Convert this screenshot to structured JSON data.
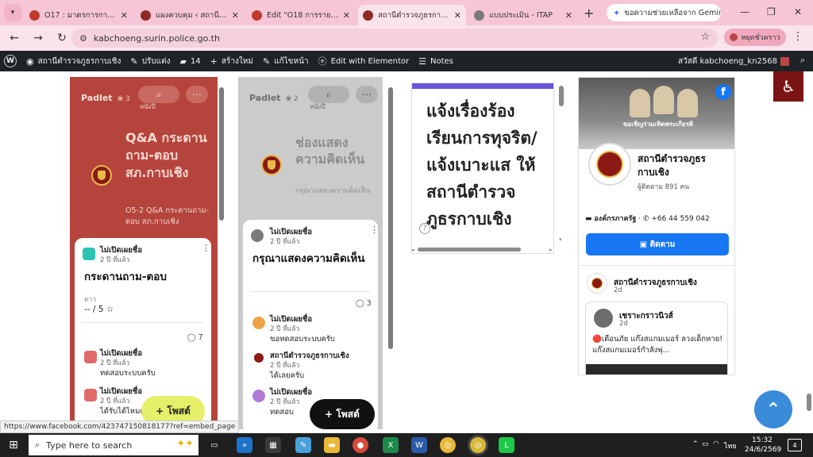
{
  "browser": {
    "tabs": [
      {
        "title": "O17 : มาตรการการแก้ไข",
        "favicon_color": "#c0392b"
      },
      {
        "title": "แผงควบคุม ‹ สถานีตำรวจ",
        "favicon_color": "#8e2a24"
      },
      {
        "title": "Edit \"O18 การรายงาน",
        "favicon_color": "#c0392b"
      },
      {
        "title": "สถานีตำรวจภูธรกาบเชิง",
        "favicon_color": "#8e2a24",
        "active": true
      },
      {
        "title": "แบบประเมิน - ITAP",
        "favicon_color": "#7a7a7a"
      }
    ],
    "new_tab_glyph": "+",
    "gemini_label": "ขอความช่วยเหลือจาก Gemini",
    "url": "kabchoeng.surin.police.go.th",
    "paused_label": "หยุดชั่วคราว",
    "status_url": "https://www.facebook.com/423747150818177?ref=embed_page"
  },
  "wpbar": {
    "site": "สถานีตำรวจภูธรกาบเชิง",
    "customize": "ปรับแต่ง",
    "comments_count": "14",
    "new": "สร้างใหม่",
    "edit_page": "แก้ไขหน้า",
    "elementor": "Edit with Elementor",
    "notes": "Notes",
    "greeting": "สวัสดี kabchoeng_kn2568"
  },
  "padlet1": {
    "brand": "Padlet",
    "count": "3",
    "search_label": "หนังปี",
    "title": "Q&A กระดานถาม-ตอบ สภ.กาบเชิง",
    "description": "O5-2 Q&A กระดานถาม-ตอบ สภ.กาบเชิง",
    "post": {
      "author": "ไม่เปิดเผยชื่อ",
      "time": "2 ปี ที่แล้ว",
      "title": "กระดานถาม-ตอบ",
      "rating_label": "ดาว",
      "rating_value": "-- / 5",
      "comments": "7"
    },
    "replies": [
      {
        "author": "ไม่เปิดเผยชื่อ",
        "time": "2 ปี ที่แล้ว",
        "text": "ทดสอบระบบครับ"
      },
      {
        "author": "ไม่เปิดเผยชื่อ",
        "time": "2 ปี ที่แล้ว",
        "text": "ได้รับได้ไหมครับ"
      }
    ],
    "post_button": "โพสต์",
    "bg_color": "#b5453c",
    "fab_color": "#e5ef6a"
  },
  "padlet2": {
    "brand": "Padlet",
    "count": "2",
    "search_label": "หนังปี",
    "title": "ช่องแสดงความคิดเห็น",
    "description": "กรุณาแสดงความคิดเห็น",
    "post": {
      "author": "ไม่เปิดเผยชื่อ",
      "time": "2 ปี ที่แล้ว",
      "title": "กรุณาแสดงความคิดเห็น",
      "comments": "3"
    },
    "replies": [
      {
        "author": "ไม่เปิดเผยชื่อ",
        "time": "2 ปี ที่แล้ว",
        "text": "ขอทดสอบระบบครับ",
        "color": "#f0a24a"
      },
      {
        "author": "สถานีตำรวจภูธรกาบเชิง",
        "time": "2 ปี ที่แล้ว",
        "text": "ได้เลยครับ",
        "color": "#8a1a14"
      },
      {
        "author": "ไม่เปิดเผยชื่อ",
        "time": "2 ปี ที่แล้ว",
        "text": "ทดสอบ",
        "color": "#b07ad8"
      }
    ],
    "post_button": "โพสต์",
    "bg_color": "#cbcbcb"
  },
  "report_text": "แจ้งเรื่องร้องเรียนการทุจริต/แจ้งเบาะแส ให้สถานีตำรวจภูธรกาบเชิง",
  "facebook": {
    "cover_caption": "ขอเชิญร่วมเทิดพระเกียรติ",
    "page_name": "สถานีตำรวจภูธรกาบเชิง",
    "followers": "ผู้ติดตาม 891 คน",
    "category": "องค์กรภาครัฐ",
    "phone": "+66 44 559 042",
    "follow_button": "ติดตาม",
    "feed_page_name": "สถานีตำรวจภูธรกาบเชิง",
    "feed_time": "2d",
    "post_author": "เชราะกราวนิวส์",
    "post_time": "2d",
    "post_text": "🔴เตือนภัย แก๊งสแกมเมอร์ ลวงเด็กหาย! แก๊งสแกมเมอร์กำลังพุ่...",
    "brand_color": "#1877f2"
  },
  "taskbar": {
    "search_placeholder": "Type here to search",
    "language": "ไทย",
    "time": "15:32",
    "date": "24/6/2569",
    "notifications": "4"
  },
  "icons": {
    "accessibility": "wheelchair-icon",
    "scroll_top": "chevron-up-icon"
  }
}
